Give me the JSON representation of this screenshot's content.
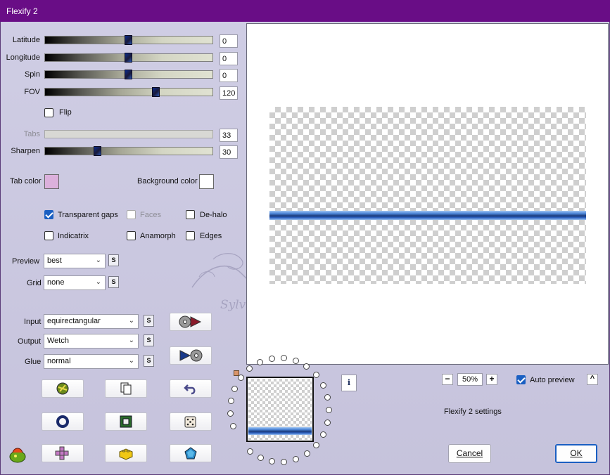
{
  "window": {
    "title": "Flexify 2"
  },
  "sliders": [
    {
      "label": "Latitude",
      "value": "0",
      "fraction": 0.5
    },
    {
      "label": "Longitude",
      "value": "0",
      "fraction": 0.5
    },
    {
      "label": "Spin",
      "value": "0",
      "fraction": 0.5
    },
    {
      "label": "FOV",
      "value": "120",
      "fraction": 0.66
    },
    {
      "label": "Tabs",
      "value": "33",
      "fraction": 0.0,
      "disabled": true
    },
    {
      "label": "Sharpen",
      "value": "30",
      "fraction": 0.3
    }
  ],
  "flip": {
    "label": "Flip",
    "checked": false
  },
  "tab_color": {
    "label": "Tab color",
    "color": "#dcb0dc"
  },
  "background_color": {
    "label": "Background color",
    "color": "#ffffff"
  },
  "options": {
    "transparent_gaps": {
      "label": "Transparent gaps",
      "checked": true
    },
    "faces": {
      "label": "Faces",
      "checked": false,
      "disabled": true
    },
    "dehalo": {
      "label": "De-halo",
      "checked": false
    },
    "indicatrix": {
      "label": "Indicatrix",
      "checked": false
    },
    "anamorph": {
      "label": "Anamorph",
      "checked": false
    },
    "edges": {
      "label": "Edges",
      "checked": false
    }
  },
  "preview_select": {
    "label": "Preview",
    "value": "best"
  },
  "grid_select": {
    "label": "Grid",
    "value": "none"
  },
  "input_select": {
    "label": "Input",
    "value": "equirectangular"
  },
  "output_select": {
    "label": "Output",
    "value": "Wetch"
  },
  "glue_select": {
    "label": "Glue",
    "value": "normal"
  },
  "s_label": "S",
  "zoom": {
    "minus": "−",
    "value": "50%",
    "plus": "+"
  },
  "auto_preview": {
    "label": "Auto preview",
    "checked": true
  },
  "collapse_label": "^",
  "info_label": "i",
  "settings_text": "Flexify 2 settings",
  "cancel_label": "Cancel",
  "ok_label": "OK",
  "watermark": "Sylviane",
  "colors": {
    "titlebar": "#690d86",
    "accent": "#1a5fc2",
    "image_band": "#2d62c2"
  }
}
